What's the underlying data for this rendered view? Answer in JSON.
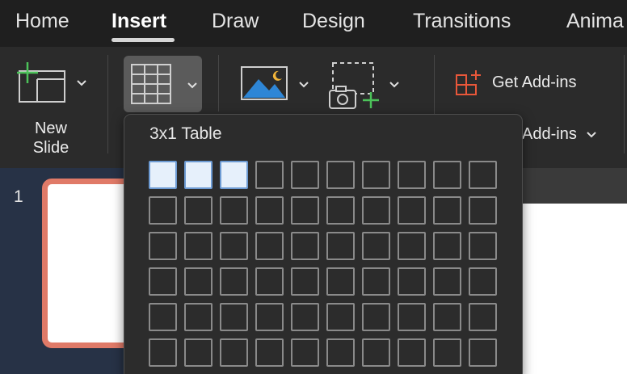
{
  "tabs": [
    {
      "label": "Home",
      "active": false
    },
    {
      "label": "Insert",
      "active": true
    },
    {
      "label": "Draw",
      "active": false
    },
    {
      "label": "Design",
      "active": false
    },
    {
      "label": "Transitions",
      "active": false
    },
    {
      "label": "Anima",
      "active": false
    }
  ],
  "ribbon": {
    "new_slide_label": "New\nSlide",
    "table_icon": "table-icon",
    "picture_icon": "picture-icon",
    "screenshot_icon": "screenshot-icon",
    "get_addins_label": "Get Add-ins",
    "addins_group_label": "Add-ins"
  },
  "table_dropdown": {
    "title": "3x1 Table",
    "columns": 10,
    "rows": 6,
    "selected_columns": 3,
    "selected_rows": 1
  },
  "thumbnails": {
    "slide_number": "1"
  },
  "colors": {
    "accent_selection": "#e6f0fb",
    "thumb_border": "#e07a68",
    "add_green": "#4cc35a",
    "addins_orange": "#e8573a"
  }
}
